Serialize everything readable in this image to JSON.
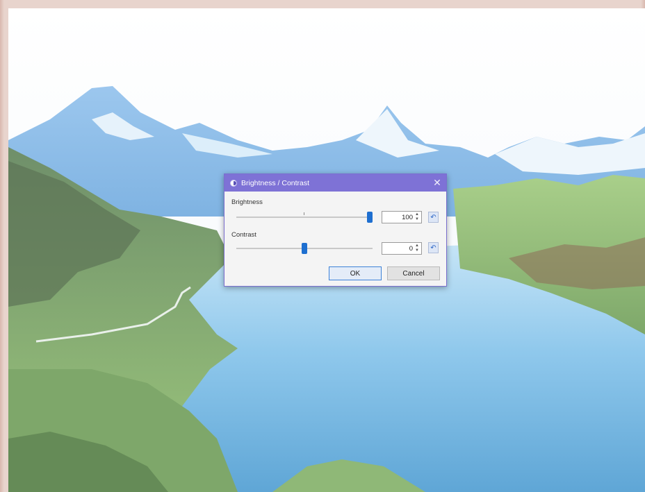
{
  "dialog": {
    "title": "Brightness / Contrast",
    "close_glyph": "✕",
    "brightness": {
      "label": "Brightness",
      "value": "100",
      "level": 1.0
    },
    "contrast": {
      "label": "Contrast",
      "value": "0",
      "level": 0.5
    },
    "reset_glyph": "↶",
    "spin_up": "▲",
    "spin_down": "▼",
    "ok_label": "OK",
    "cancel_label": "Cancel"
  },
  "colors": {
    "title_bar": "#7e72d6",
    "slider_thumb": "#1e6fd0",
    "dialog_bg": "#f4f4f4"
  },
  "icons": {
    "title": "brightness-contrast-icon",
    "close": "close-icon",
    "reset": "reset-icon"
  }
}
